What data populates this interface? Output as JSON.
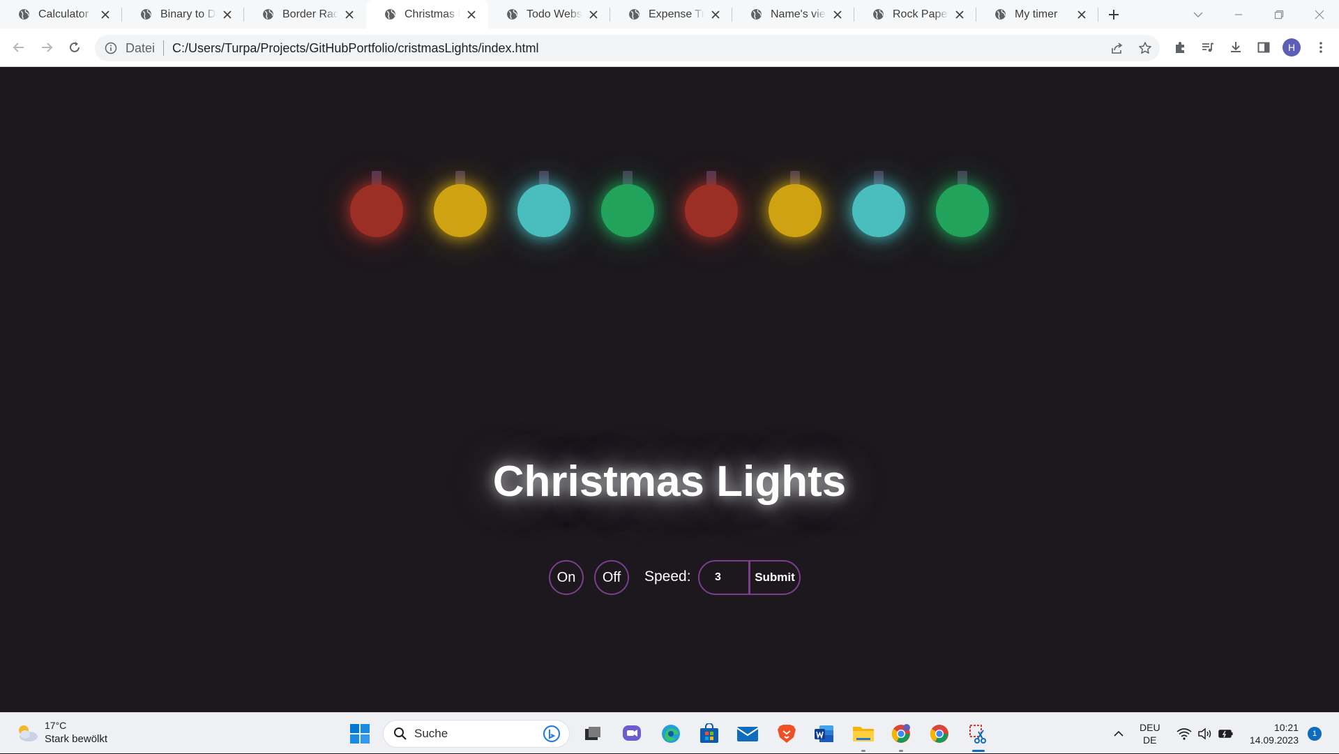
{
  "browser": {
    "tabs": [
      {
        "title": "Calculator",
        "icon": "globe-icon",
        "active": false
      },
      {
        "title": "Binary to Decimal",
        "icon": "globe-icon",
        "active": false
      },
      {
        "title": "Border Radius",
        "icon": "globe-icon",
        "active": false
      },
      {
        "title": "Christmas Lights",
        "icon": "globe-icon",
        "active": true
      },
      {
        "title": "Todo Website",
        "icon": "globe-icon",
        "active": false
      },
      {
        "title": "Expense Tracker",
        "icon": "globe-icon",
        "active": false
      },
      {
        "title": "Name's viewer",
        "icon": "globe-icon",
        "active": false
      },
      {
        "title": "Rock Paper Scissors",
        "icon": "globe-icon",
        "active": false
      },
      {
        "title": "My timer",
        "icon": "globe-icon",
        "active": false
      }
    ],
    "address": {
      "scheme_label": "Datei",
      "url": "C:/Users/Turpa/Projects/GitHubPortfolio/cristmasLights/index.html"
    },
    "profile_initial": "H"
  },
  "page": {
    "title": "Christmas Lights",
    "bulbs": [
      {
        "color": "#9c2f25",
        "glow": "#c03428"
      },
      {
        "color": "#cfa213",
        "glow": "#e3b20f"
      },
      {
        "color": "#4abdbd",
        "glow": "#47c8c8"
      },
      {
        "color": "#22a35b",
        "glow": "#1fb864"
      },
      {
        "color": "#9c2f25",
        "glow": "#c03428"
      },
      {
        "color": "#cfa213",
        "glow": "#e3b20f"
      },
      {
        "color": "#4abdbd",
        "glow": "#47c8c8"
      },
      {
        "color": "#22a35b",
        "glow": "#1fb864"
      }
    ],
    "controls": {
      "on_label": "On",
      "off_label": "Off",
      "speed_label": "Speed:",
      "speed_value": "3",
      "submit_label": "Submit"
    }
  },
  "taskbar": {
    "weather": {
      "temperature": "17°C",
      "description": "Stark bewölkt"
    },
    "search_placeholder": "Suche",
    "language": {
      "line1": "DEU",
      "line2": "DE"
    },
    "clock": {
      "time": "10:21",
      "date": "14.09.2023"
    },
    "notification_count": "1"
  }
}
